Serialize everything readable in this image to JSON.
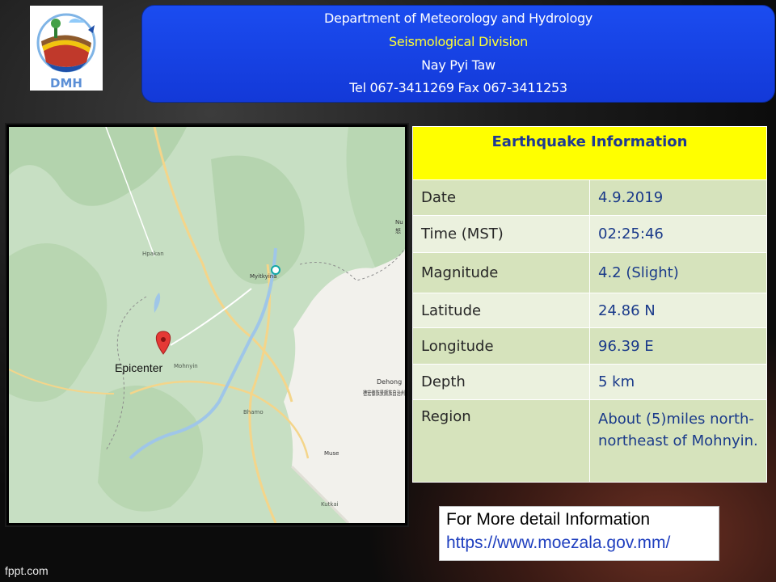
{
  "header": {
    "logo_text": "DMH",
    "line_1": "Department of Meteorology and Hydrology",
    "line_2": "Seismological Division",
    "line_3": "Nay Pyi Taw",
    "line_4": "Tel 067-3411269 Fax 067-3411253"
  },
  "map": {
    "epicenter_label": "Epicenter",
    "places": {
      "hpakan": "Hpakan",
      "myitkyina": "Myitkyina",
      "mohnyin": "Mohnyin",
      "bhamo": "Bhamo",
      "dehong": "Dehong",
      "dehong_cn": "德宏傣族景颇族自治州",
      "muse": "Muse",
      "kutkai": "Kutkai",
      "nu": "Nu",
      "nu_cn": "怒"
    }
  },
  "info": {
    "title": "Earthquake Information",
    "rows": [
      {
        "label": "Date",
        "value": "4.9.2019"
      },
      {
        "label": "Time (MST)",
        "value": "02:25:46"
      },
      {
        "label": "Magnitude",
        "value": "4.2 (Slight)"
      },
      {
        "label": "Latitude",
        "value": "24.86 N"
      },
      {
        "label": "Longitude",
        "value": "96.39 E"
      },
      {
        "label": "Depth",
        "value": "5 km"
      },
      {
        "label": "Region",
        "value": "About (5)miles north-northeast of Mohnyin."
      }
    ]
  },
  "more_info": {
    "title": "For More detail Information",
    "url": "https://www.moezala.gov.mm/"
  },
  "footer": {
    "brand": "fppt.com"
  },
  "colors": {
    "header_bg": "#1b4cf0",
    "header_highlight": "#ffff33",
    "table_title_bg": "#ffff00",
    "table_row_dark": "#d6e3bc",
    "table_row_light": "#ebf1de",
    "value_text": "#1a3a8a",
    "epicenter_pin": "#e53935",
    "link": "#1f3fbf"
  }
}
